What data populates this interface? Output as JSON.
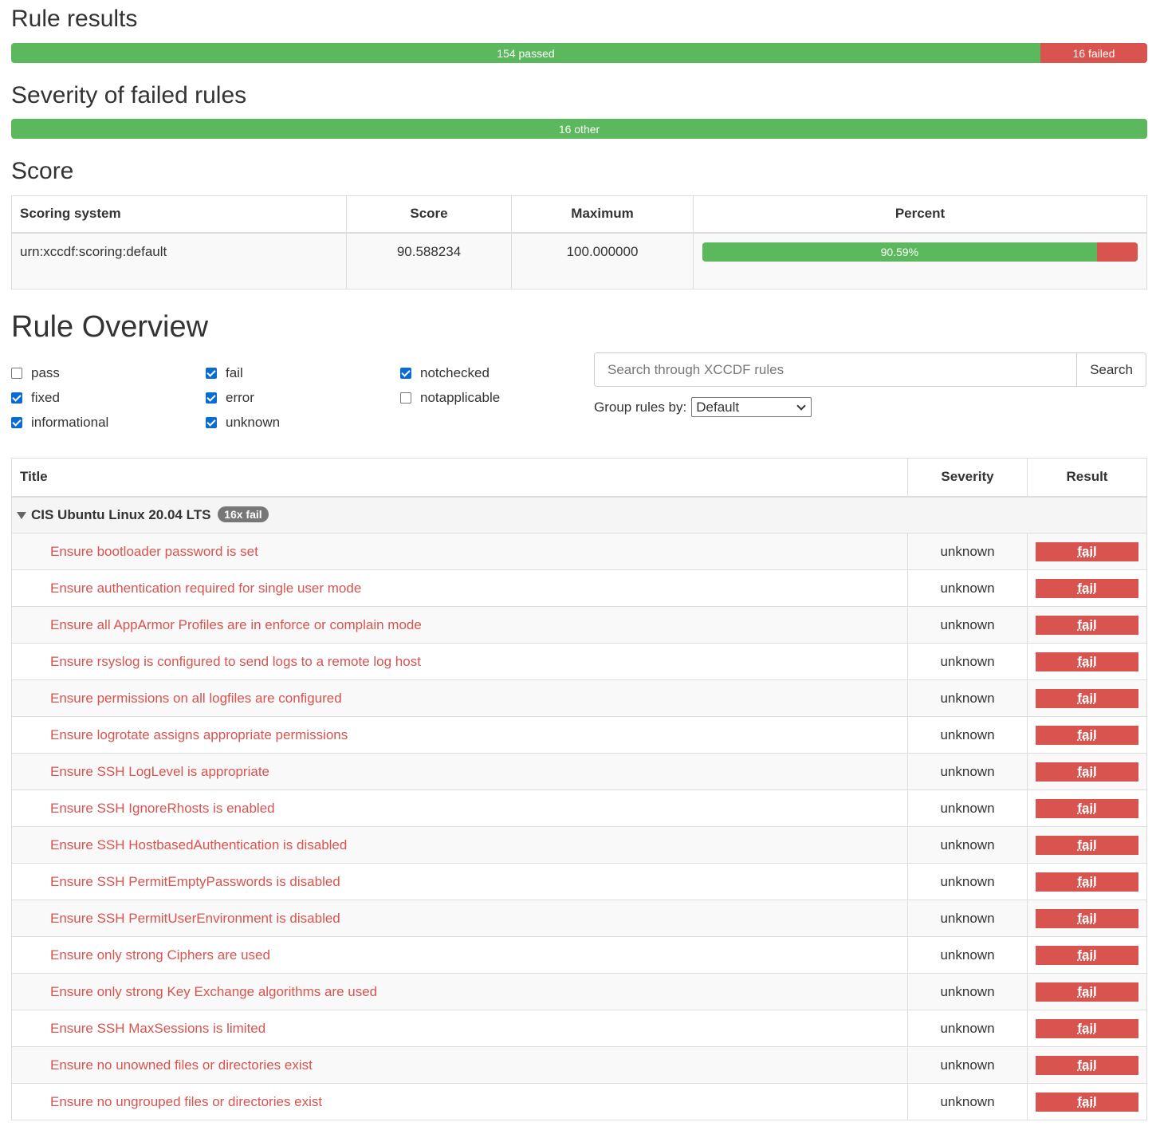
{
  "rule_results": {
    "heading": "Rule results",
    "passed_label": "154 passed",
    "failed_label": "16 failed",
    "passed_fraction": 0.9059,
    "colors": {
      "pass": "#5cb85c",
      "fail": "#d9534f"
    }
  },
  "severity": {
    "heading": "Severity of failed rules",
    "other_label": "16 other"
  },
  "score": {
    "heading": "Score",
    "columns": [
      "Scoring system",
      "Score",
      "Maximum",
      "Percent"
    ],
    "row": {
      "system": "urn:xccdf:scoring:default",
      "score": "90.588234",
      "maximum": "100.000000",
      "percent_label": "90.59%",
      "percent_value": 90.59
    }
  },
  "overview": {
    "heading": "Rule Overview",
    "filters": [
      {
        "label": "pass",
        "checked": false
      },
      {
        "label": "fixed",
        "checked": true
      },
      {
        "label": "informational",
        "checked": true
      },
      {
        "label": "fail",
        "checked": true
      },
      {
        "label": "error",
        "checked": true
      },
      {
        "label": "unknown",
        "checked": true
      },
      {
        "label": "notchecked",
        "checked": true
      },
      {
        "label": "notapplicable",
        "checked": false
      }
    ],
    "search": {
      "placeholder": "Search through XCCDF rules",
      "button": "Search"
    },
    "group_by": {
      "label": "Group rules by:",
      "selected": "Default"
    }
  },
  "rules_table": {
    "columns": {
      "title": "Title",
      "severity": "Severity",
      "result": "Result"
    },
    "group": {
      "name": "CIS Ubuntu Linux 20.04 LTS",
      "badge": "16x fail"
    },
    "rows": [
      {
        "title": "Ensure bootloader password is set",
        "severity": "unknown",
        "result": "fail"
      },
      {
        "title": "Ensure authentication required for single user mode",
        "severity": "unknown",
        "result": "fail"
      },
      {
        "title": "Ensure all AppArmor Profiles are in enforce or complain mode",
        "severity": "unknown",
        "result": "fail"
      },
      {
        "title": "Ensure rsyslog is configured to send logs to a remote log host",
        "severity": "unknown",
        "result": "fail"
      },
      {
        "title": "Ensure permissions on all logfiles are configured",
        "severity": "unknown",
        "result": "fail"
      },
      {
        "title": "Ensure logrotate assigns appropriate permissions",
        "severity": "unknown",
        "result": "fail"
      },
      {
        "title": "Ensure SSH LogLevel is appropriate",
        "severity": "unknown",
        "result": "fail"
      },
      {
        "title": "Ensure SSH IgnoreRhosts is enabled",
        "severity": "unknown",
        "result": "fail"
      },
      {
        "title": "Ensure SSH HostbasedAuthentication is disabled",
        "severity": "unknown",
        "result": "fail"
      },
      {
        "title": "Ensure SSH PermitEmptyPasswords is disabled",
        "severity": "unknown",
        "result": "fail"
      },
      {
        "title": "Ensure SSH PermitUserEnvironment is disabled",
        "severity": "unknown",
        "result": "fail"
      },
      {
        "title": "Ensure only strong Ciphers are used",
        "severity": "unknown",
        "result": "fail"
      },
      {
        "title": "Ensure only strong Key Exchange algorithms are used",
        "severity": "unknown",
        "result": "fail"
      },
      {
        "title": "Ensure SSH MaxSessions is limited",
        "severity": "unknown",
        "result": "fail"
      },
      {
        "title": "Ensure no unowned files or directories exist",
        "severity": "unknown",
        "result": "fail"
      },
      {
        "title": "Ensure no ungrouped files or directories exist",
        "severity": "unknown",
        "result": "fail"
      }
    ]
  }
}
